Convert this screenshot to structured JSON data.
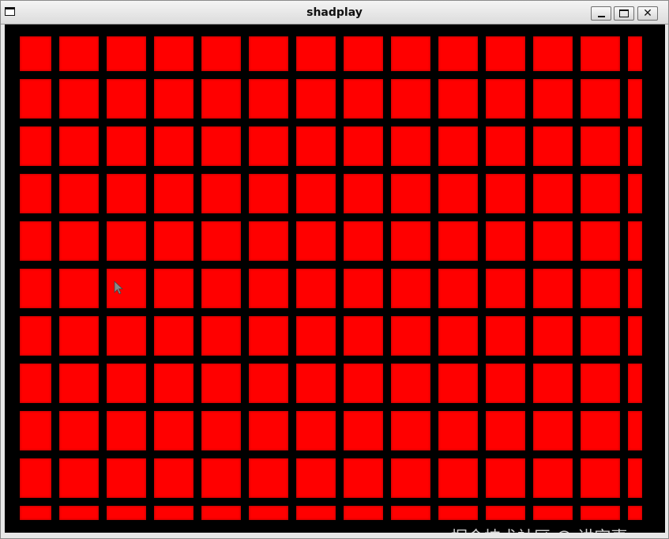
{
  "window": {
    "title": "shadplay",
    "icons": {
      "app": "window-icon",
      "minimize": "minimize-icon",
      "maximize": "maximize-icon",
      "close": "close-icon"
    },
    "close_glyph": "✕"
  },
  "canvas": {
    "background_color": "#000000",
    "cell_color": "#ff0000",
    "rows": 11,
    "columns": 14
  },
  "watermark": {
    "text": "掘金技术社区 @ 讲究事"
  }
}
